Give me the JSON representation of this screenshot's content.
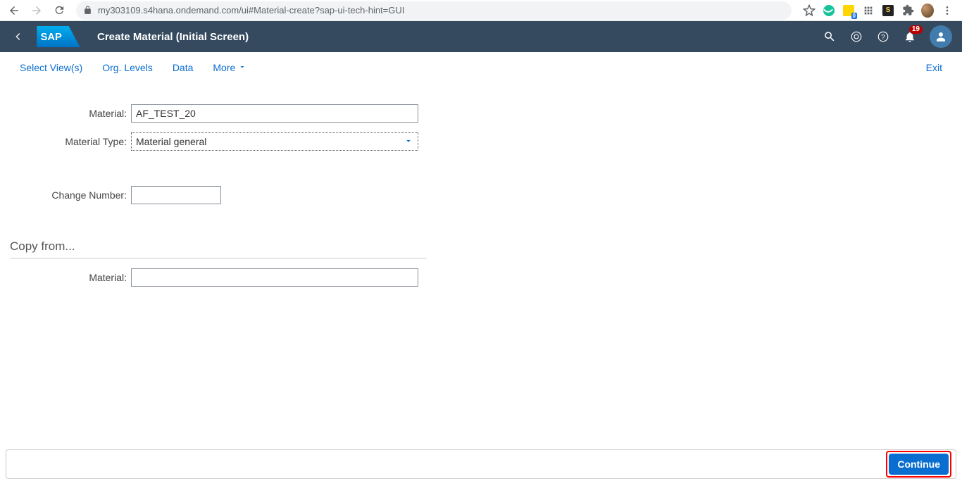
{
  "browser": {
    "url": "my303109.s4hana.ondemand.com/ui#Material-create?sap-ui-tech-hint=GUI",
    "yellow_badge": "0"
  },
  "header": {
    "title": "Create Material (Initial Screen)",
    "notification_count": "19"
  },
  "toolbar": {
    "select_views": "Select View(s)",
    "org_levels": "Org. Levels",
    "data": "Data",
    "more": "More",
    "exit": "Exit"
  },
  "form": {
    "material_label": "Material:",
    "material_value": "AF_TEST_20",
    "material_type_label": "Material Type:",
    "material_type_value": "Material general",
    "change_number_label": "Change Number:",
    "change_number_value": "",
    "copy_from_header": "Copy from...",
    "copy_material_label": "Material:",
    "copy_material_value": ""
  },
  "footer": {
    "continue": "Continue"
  }
}
